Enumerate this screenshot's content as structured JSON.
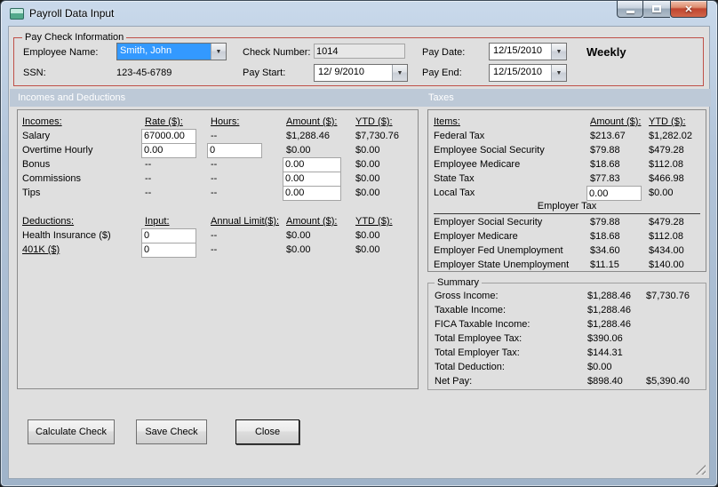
{
  "window": {
    "title": "Payroll Data Input",
    "controls": {
      "close_glyph": "✕"
    }
  },
  "icons": {
    "dropdown_arrow": "▼"
  },
  "paycheck": {
    "group_label": "Pay Check Information",
    "labels": {
      "employee_name": "Employee Name:",
      "ssn": "SSN:",
      "check_number": "Check Number:",
      "pay_start": "Pay Start:",
      "pay_date": "Pay Date:",
      "pay_end": "Pay End:"
    },
    "values": {
      "employee_name": "Smith, John",
      "ssn": "123-45-6789",
      "check_number": "1014",
      "pay_start": "12/ 9/2010",
      "pay_date": "12/15/2010",
      "pay_end": "12/15/2010",
      "frequency": "Weekly"
    }
  },
  "section_headers": {
    "left": "Incomes and Deductions",
    "right": "Taxes"
  },
  "incomes": {
    "headers": {
      "item": "Incomes:",
      "rate": "Rate ($):",
      "hours": "Hours:",
      "amount": "Amount ($):",
      "ytd": "YTD ($):"
    },
    "rows": [
      {
        "label": "Salary",
        "rate": "67000.00",
        "hours": "--",
        "amount": "$1,288.46",
        "ytd": "$7,730.76"
      },
      {
        "label": "Overtime Hourly",
        "rate": "0.00",
        "hours": "0",
        "amount": "$0.00",
        "ytd": "$0.00"
      },
      {
        "label": "Bonus",
        "rate": "--",
        "hours": "--",
        "amount": "0.00",
        "ytd": "$0.00"
      },
      {
        "label": "Commissions",
        "rate": "--",
        "hours": "--",
        "amount": "0.00",
        "ytd": "$0.00"
      },
      {
        "label": "Tips",
        "rate": "--",
        "hours": "--",
        "amount": "0.00",
        "ytd": "$0.00"
      }
    ]
  },
  "deductions": {
    "headers": {
      "item": "Deductions:",
      "input": "Input:",
      "limit": "Annual Limit($):",
      "amount": "Amount ($):",
      "ytd": "YTD ($):"
    },
    "rows": [
      {
        "label": "Health Insurance  ($)",
        "input": "0",
        "limit": "--",
        "amount": "$0.00",
        "ytd": "$0.00"
      },
      {
        "label": "401K  ($)",
        "input": "0",
        "limit": "--",
        "amount": "$0.00",
        "ytd": "$0.00"
      }
    ]
  },
  "taxes": {
    "headers": {
      "item": "Items:",
      "amount": "Amount ($):",
      "ytd": "YTD ($):"
    },
    "employee_rows": [
      {
        "label": "Federal Tax",
        "amount": "$213.67",
        "ytd": "$1,282.02"
      },
      {
        "label": "Employee Social Security",
        "amount": "$79.88",
        "ytd": "$479.28"
      },
      {
        "label": "Employee Medicare",
        "amount": "$18.68",
        "ytd": "$112.08"
      },
      {
        "label": "State Tax",
        "amount": "$77.83",
        "ytd": "$466.98"
      },
      {
        "label": "Local Tax",
        "amount": "0.00",
        "ytd": "$0.00"
      }
    ],
    "employer_header": "Employer Tax",
    "employer_rows": [
      {
        "label": "Employer Social Security",
        "amount": "$79.88",
        "ytd": "$479.28"
      },
      {
        "label": "Employer Medicare",
        "amount": "$18.68",
        "ytd": "$112.08"
      },
      {
        "label": "Employer Fed Unemployment",
        "amount": "$34.60",
        "ytd": "$434.00"
      },
      {
        "label": "Employer State Unemployment",
        "amount": "$11.15",
        "ytd": "$140.00"
      }
    ]
  },
  "summary": {
    "group_label": "Summary",
    "rows": [
      {
        "label": "Gross Income:",
        "amount": "$1,288.46",
        "ytd": "$7,730.76"
      },
      {
        "label": "Taxable Income:",
        "amount": "$1,288.46",
        "ytd": ""
      },
      {
        "label": "FICA Taxable Income:",
        "amount": "$1,288.46",
        "ytd": ""
      },
      {
        "label": "Total Employee Tax:",
        "amount": "$390.06",
        "ytd": ""
      },
      {
        "label": "Total Employer Tax:",
        "amount": "$144.31",
        "ytd": ""
      },
      {
        "label": "Total Deduction:",
        "amount": "$0.00",
        "ytd": ""
      },
      {
        "label": "Net Pay:",
        "amount": "$898.40",
        "ytd": "$5,390.40"
      }
    ]
  },
  "buttons": {
    "calculate": "Calculate Check",
    "save": "Save Check",
    "close": "Close"
  },
  "colors": {
    "group_border": "#BF5048",
    "section_header_bg": "#BDC9D7",
    "combo_selection": "#3399FF",
    "close_button": "#C0452F",
    "form_bg": "#DFDFDF"
  }
}
